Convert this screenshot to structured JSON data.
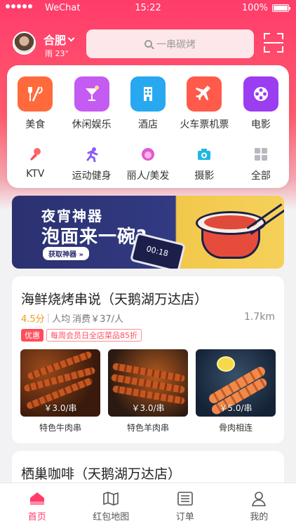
{
  "status_bar": {
    "carrier": "WeChat",
    "time": "15:22",
    "battery": "100%"
  },
  "header": {
    "city": "合肥",
    "weather": "雨 23°",
    "search_placeholder": "一串碳烤"
  },
  "categories_primary": [
    {
      "label": "美食",
      "icon": "fork-knife-icon",
      "color": "#ff6a3d"
    },
    {
      "label": "休闲娱乐",
      "icon": "cocktail-icon",
      "color": "#c45bf2"
    },
    {
      "label": "酒店",
      "icon": "hotel-icon",
      "color": "#28a8f0"
    },
    {
      "label": "火车票机票",
      "icon": "airplane-icon",
      "color": "#ff5a4a"
    },
    {
      "label": "电影",
      "icon": "film-reel-icon",
      "color": "#9b3df0"
    }
  ],
  "categories_secondary": [
    {
      "label": "KTV",
      "icon": "microphone-icon"
    },
    {
      "label": "运动健身",
      "icon": "runner-icon"
    },
    {
      "label": "丽人/美发",
      "icon": "beauty-icon"
    },
    {
      "label": "摄影",
      "icon": "camera-icon"
    },
    {
      "label": "全部",
      "icon": "grid-icon"
    }
  ],
  "banner": {
    "title": "夜宵神器",
    "subtitle": "泡面来一碗?",
    "button": "获取神器",
    "phone_time": "00:18"
  },
  "shop1": {
    "name": "海鲜烧烤串说（天鹅湖万达店）",
    "score": "4.5分",
    "avg_label": "人均",
    "avg_price": "消费￥37/人",
    "distance": "1.7km",
    "promo_tag": "优惠",
    "promo_text": "每周会员日全店菜品85折",
    "dishes": [
      {
        "name": "特色牛肉串",
        "price": "￥3.0/串"
      },
      {
        "name": "特色羊肉串",
        "price": "￥3.0/串"
      },
      {
        "name": "骨肉相连",
        "price": "￥5.0/串"
      }
    ]
  },
  "shop2": {
    "name": "栖巢咖啡（天鹅湖万达店）"
  },
  "tabbar": [
    {
      "label": "首页",
      "icon": "home-icon",
      "active": true
    },
    {
      "label": "红包地图",
      "icon": "map-icon",
      "active": false
    },
    {
      "label": "订单",
      "icon": "order-icon",
      "active": false
    },
    {
      "label": "我的",
      "icon": "user-icon",
      "active": false
    }
  ],
  "colors": {
    "accent": "#ff3c6a",
    "score": "#f29a1a"
  }
}
